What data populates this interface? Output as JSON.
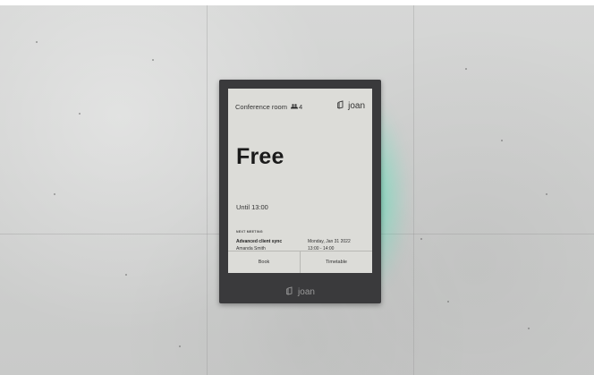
{
  "screen": {
    "room_name": "Conference room",
    "capacity": "4",
    "brand": "joan",
    "status": "Free",
    "until": "Until 13:00",
    "next_meeting": {
      "label": "NEXT MEETING",
      "title": "Advanced client sync",
      "organizer": "Amanda Smith",
      "date": "Monday, Jan 31 2022",
      "time": "13:00 - 14:00"
    },
    "actions": {
      "book": "Book",
      "timetable": "Timetable"
    }
  },
  "device": {
    "brand": "joan"
  },
  "colors": {
    "glow": "#3ce6b4",
    "frame": "#3a3a3c",
    "screen": "#dcdcd8"
  },
  "icons": [
    "people-icon",
    "joan-logo-icon"
  ]
}
